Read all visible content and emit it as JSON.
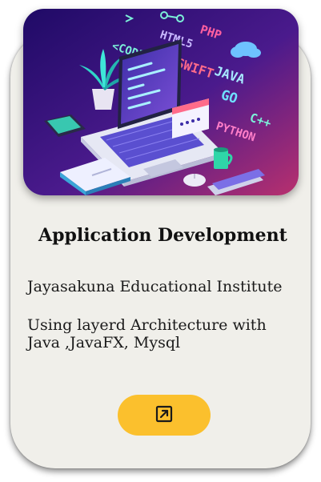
{
  "card": {
    "hero_image": {
      "icon": "laptop-programming-illustration",
      "tech_labels": [
        "<CODE>",
        "HTML5",
        "PHP",
        "SWIFT",
        "JAVA",
        "GO",
        "C++",
        "PYTHON"
      ]
    },
    "title": "Application Development",
    "organization": "Jayasakuna Educational Institute",
    "description": "Using layerd Architecture with Java ,JavaFX, Mysql",
    "open_button": {
      "icon": "open-in-new-icon",
      "color": "#fbc02d"
    }
  },
  "colors": {
    "card_background": "#f0efea",
    "button_accent": "#fbc02d"
  }
}
